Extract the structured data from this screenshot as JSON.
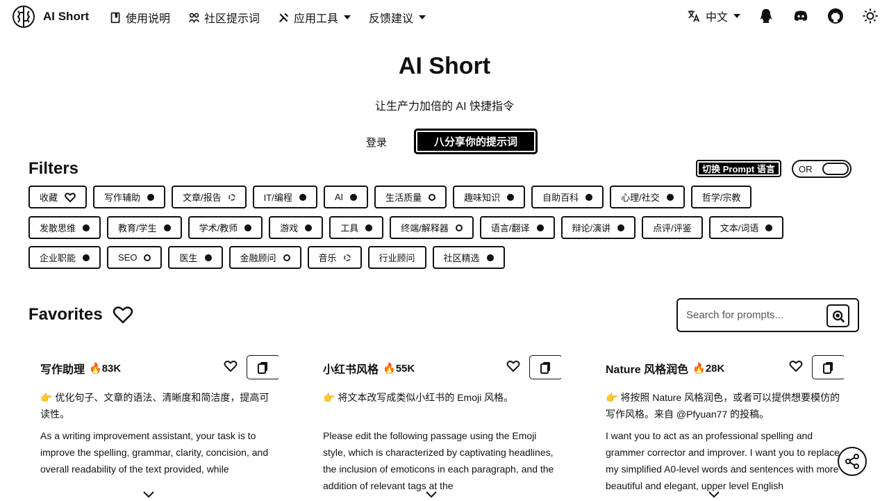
{
  "brand": {
    "name": "AI Short"
  },
  "nav": {
    "links": [
      {
        "label": "使用说明",
        "icon": "book-icon"
      },
      {
        "label": "社区提示词",
        "icon": "community-icon"
      },
      {
        "label": "应用工具",
        "icon": "tools-icon",
        "dropdown": true
      },
      {
        "label": "反馈建议",
        "icon": "",
        "dropdown": true
      }
    ],
    "language": "中文"
  },
  "hero": {
    "title": "AI Short",
    "subtitle": "让生产力加倍的 AI 快捷指令",
    "login": "登录",
    "share_button": "八分享你的提示词"
  },
  "filters": {
    "title": "Filters",
    "switch_lang_button": "切换 Prompt 语言",
    "toggle_label": "OR",
    "rows": [
      [
        {
          "label": "收藏",
          "mark": "heart"
        },
        {
          "label": "写作辅助",
          "mark": "filled"
        },
        {
          "label": "文章/报告",
          "mark": "dash"
        },
        {
          "label": "IT/编程",
          "mark": "filled"
        },
        {
          "label": "AI",
          "mark": "filled"
        },
        {
          "label": "生活质量",
          "mark": "ring"
        },
        {
          "label": "趣味知识",
          "mark": "filled"
        },
        {
          "label": "自助百科",
          "mark": "filled"
        },
        {
          "label": "心理/社交",
          "mark": "filled"
        },
        {
          "label": "哲学/宗教",
          "mark": "none"
        }
      ],
      [
        {
          "label": "发散思维",
          "mark": "filled"
        },
        {
          "label": "教育/学生",
          "mark": "filled"
        },
        {
          "label": "学术/教师",
          "mark": "filled"
        },
        {
          "label": "游戏",
          "mark": "filled"
        },
        {
          "label": "工具",
          "mark": "filled"
        },
        {
          "label": "终端/解释器",
          "mark": "ring"
        },
        {
          "label": "语言/翻译",
          "mark": "filled"
        },
        {
          "label": "辩论/演讲",
          "mark": "filled"
        },
        {
          "label": "点评/评鉴",
          "mark": "none"
        },
        {
          "label": "文本/词语",
          "mark": "filled"
        }
      ],
      [
        {
          "label": "企业职能",
          "mark": "filled"
        },
        {
          "label": "SEO",
          "mark": "ring"
        },
        {
          "label": "医生",
          "mark": "filled"
        },
        {
          "label": "金融顾问",
          "mark": "ring"
        },
        {
          "label": "音乐",
          "mark": "dash"
        },
        {
          "label": "行业顾问",
          "mark": "none"
        },
        {
          "label": "社区精选",
          "mark": "filled"
        }
      ]
    ]
  },
  "favorites": {
    "title": "Favorites",
    "search_placeholder": "Search for prompts..."
  },
  "cards": [
    {
      "title": "写作助理",
      "count": "🔥83K",
      "desc": "👉 优化句子、文章的语法、清晰度和简洁度，提高可读性。",
      "body": "As a writing improvement assistant, your task is to improve the spelling, grammar, clarity, concision, and overall readability of the text provided, while"
    },
    {
      "title": "小红书风格",
      "count": "🔥55K",
      "desc": "👉 将文本改写成类似小红书的 Emoji 风格。",
      "body": "Please edit the following passage using the Emoji style, which is characterized by captivating headlines, the inclusion of emoticons in each paragraph, and the addition of relevant tags at the"
    },
    {
      "title": "Nature 风格润色",
      "count": "🔥28K",
      "desc": "👉 将按照 Nature 风格润色，或者可以提供想要模仿的写作风格。来自 @Pfyuan77 的投稿。",
      "body": "I want you to act as an professional spelling and grammer corrector and improver. I want you to replace my simplified A0-level words and sentences with more beautiful and elegant, upper level English"
    }
  ]
}
